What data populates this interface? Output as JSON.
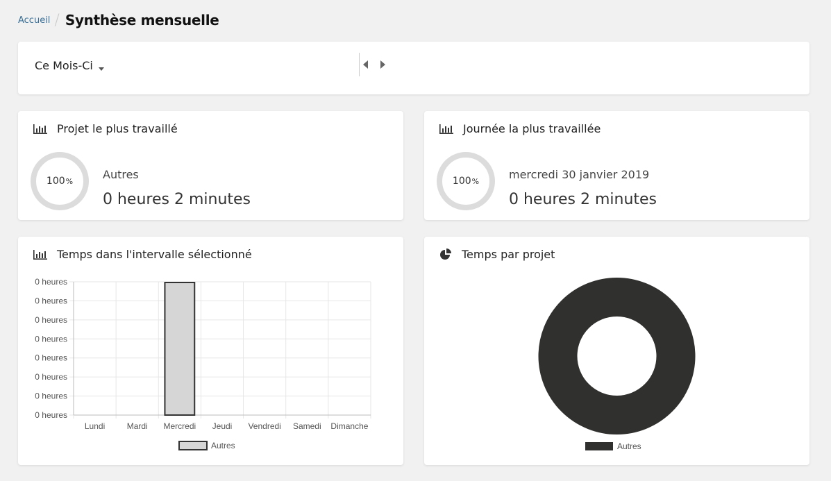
{
  "breadcrumb": {
    "home": "Accueil",
    "title": "Synthèse mensuelle"
  },
  "filter": {
    "period": "Ce Mois-Ci"
  },
  "cards": {
    "most_project": {
      "title": "Projet le plus travaillé",
      "percent": "100",
      "percent_sign": "%",
      "name": "Autres",
      "duration": "0 heures 2 minutes",
      "icon": "bar-chart-icon"
    },
    "most_day": {
      "title": "Journée la plus travaillée",
      "percent": "100",
      "percent_sign": "%",
      "name": "mercredi 30 janvier 2019",
      "duration": "0 heures 2 minutes",
      "icon": "bar-chart-icon"
    },
    "interval": {
      "title": "Temps dans l'intervalle sélectionné",
      "icon": "bar-chart-icon"
    },
    "per_project": {
      "title": "Temps par projet",
      "icon": "pie-chart-icon"
    }
  },
  "chart_data": [
    {
      "type": "bar",
      "categories": [
        "Lundi",
        "Mardi",
        "Mercredi",
        "Jeudi",
        "Vendredi",
        "Samedi",
        "Dimanche"
      ],
      "series": [
        {
          "name": "Autres",
          "values": [
            0,
            0,
            0.035,
            0,
            0,
            0,
            0
          ],
          "color": "#d6d6d6",
          "border": "#333333"
        }
      ],
      "y_tick_labels": [
        "0 heures",
        "0 heures",
        "0 heures",
        "0 heures",
        "0 heures",
        "0 heures",
        "0 heures",
        "0 heures"
      ],
      "ylim": [
        0,
        0.035
      ],
      "grid": true,
      "legend": "bottom"
    },
    {
      "type": "pie",
      "donut": true,
      "labels": [
        "Autres"
      ],
      "values": [
        100
      ],
      "colors": [
        "#30312e"
      ],
      "legend": "bottom"
    }
  ]
}
